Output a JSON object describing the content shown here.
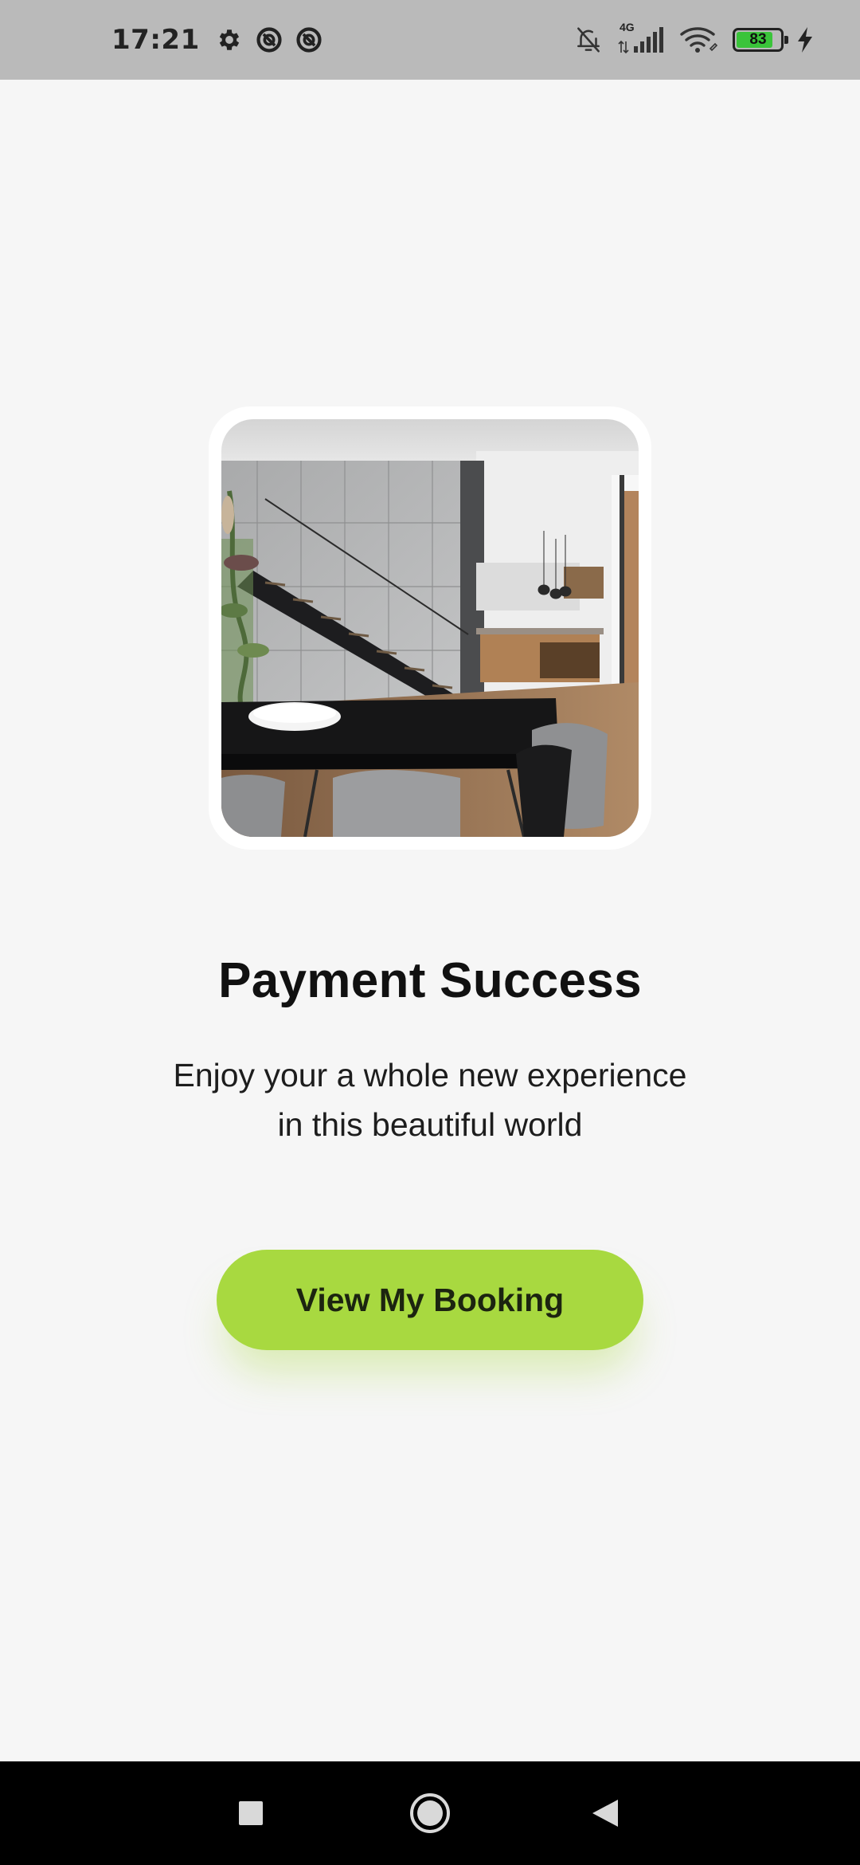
{
  "status_bar": {
    "time": "17:21",
    "left_icons": [
      "gear-icon",
      "sync-icon",
      "sync-icon"
    ],
    "network_type": "4G",
    "battery_level": "83",
    "right_icons": [
      "bell-off-icon",
      "signal-icon",
      "wifi-icon",
      "battery-icon",
      "charging-icon"
    ]
  },
  "main": {
    "image_alt": "modern interior dining room",
    "title": "Payment Success",
    "subtitle_line1": "Enjoy your a whole new experience",
    "subtitle_line2": "in this beautiful world",
    "cta_label": "View My Booking"
  },
  "colors": {
    "background": "#f6f6f6",
    "accent": "#a8d940",
    "status_bar": "#bababa",
    "nav_bar": "#000000"
  },
  "nav_bar": {
    "icons": [
      "square-recents-icon",
      "circle-home-icon",
      "triangle-back-icon"
    ]
  }
}
